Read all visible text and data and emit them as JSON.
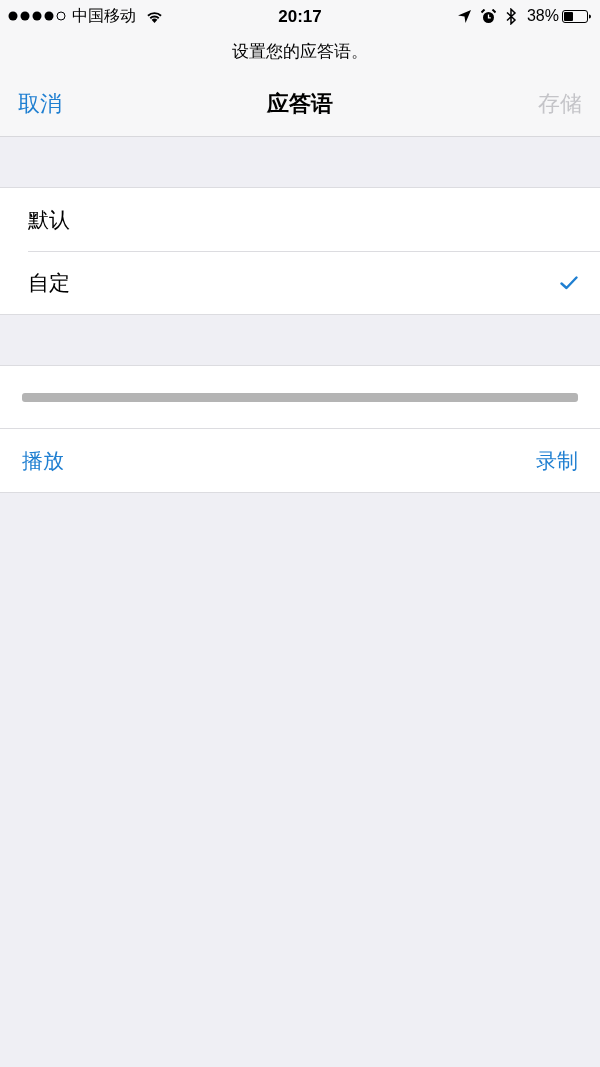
{
  "status_bar": {
    "carrier": "中国移动",
    "time": "20:17",
    "battery": "38%"
  },
  "prompt": "设置您的应答语。",
  "nav": {
    "cancel": "取消",
    "title": "应答语",
    "save": {
      "label": "存储",
      "disabled": true
    }
  },
  "options": [
    {
      "label": "默认",
      "selected": false
    },
    {
      "label": "自定",
      "selected": true
    }
  ],
  "recording": {
    "actions": [
      {
        "label": "播放"
      },
      {
        "label": "录制"
      }
    ]
  }
}
